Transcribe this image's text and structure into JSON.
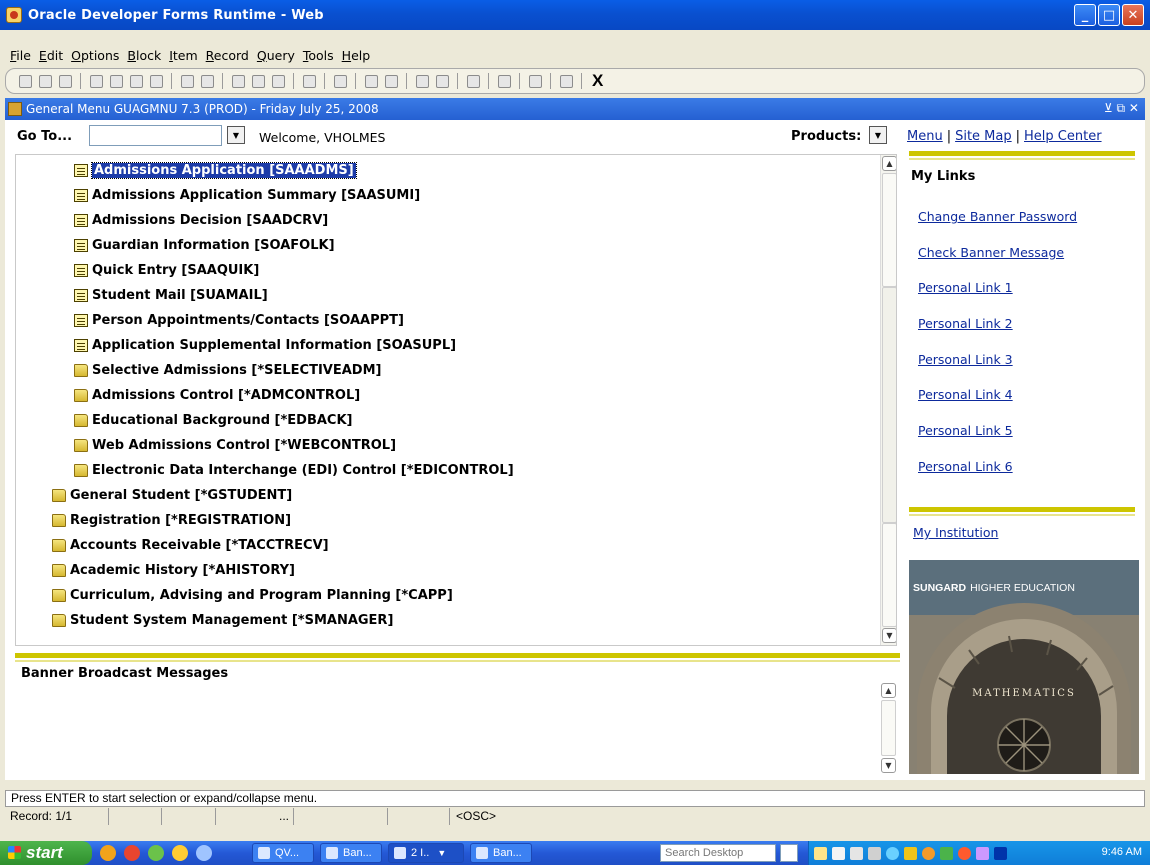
{
  "window": {
    "title": "Oracle Developer Forms Runtime - Web"
  },
  "menubar": [
    "File",
    "Edit",
    "Options",
    "Block",
    "Item",
    "Record",
    "Query",
    "Tools",
    "Help"
  ],
  "toolbar": {
    "exit_label": "X"
  },
  "form": {
    "title": "General Menu  GUAGMNU  7.3  (PROD) - Friday July 25, 2008"
  },
  "goto": {
    "label": "Go To...",
    "value": "",
    "welcome": "Welcome, VHOLMES",
    "products_label": "Products:"
  },
  "tree": {
    "items": [
      {
        "label": "Admissions Application [SAAADMS]",
        "type": "form",
        "level": 2,
        "selected": true
      },
      {
        "label": "Admissions Application Summary [SAASUMI]",
        "type": "form",
        "level": 2
      },
      {
        "label": "Admissions Decision [SAADCRV]",
        "type": "form",
        "level": 2
      },
      {
        "label": "Guardian Information [SOAFOLK]",
        "type": "form",
        "level": 2
      },
      {
        "label": "Quick Entry [SAAQUIK]",
        "type": "form",
        "level": 2
      },
      {
        "label": "Student Mail [SUAMAIL]",
        "type": "form",
        "level": 2
      },
      {
        "label": "Person Appointments/Contacts [SOAAPPT]",
        "type": "form",
        "level": 2
      },
      {
        "label": "Application Supplemental Information [SOASUPL]",
        "type": "form",
        "level": 2
      },
      {
        "label": "Selective Admissions [*SELECTIVEADM]",
        "type": "folder",
        "level": 2
      },
      {
        "label": "Admissions Control [*ADMCONTROL]",
        "type": "folder",
        "level": 2
      },
      {
        "label": "Educational Background [*EDBACK]",
        "type": "folder",
        "level": 2
      },
      {
        "label": "Web Admissions Control [*WEBCONTROL]",
        "type": "folder",
        "level": 2
      },
      {
        "label": "Electronic Data Interchange (EDI) Control [*EDICONTROL]",
        "type": "folder",
        "level": 2
      },
      {
        "label": "General Student [*GSTUDENT]",
        "type": "folder",
        "level": 1
      },
      {
        "label": "Registration [*REGISTRATION]",
        "type": "folder",
        "level": 1
      },
      {
        "label": "Accounts Receivable [*TACCTRECV]",
        "type": "folder",
        "level": 1
      },
      {
        "label": "Academic History [*AHISTORY]",
        "type": "folder",
        "level": 1
      },
      {
        "label": "Curriculum, Advising and Program Planning [*CAPP]",
        "type": "folder",
        "level": 1
      },
      {
        "label": "Student System Management [*SMANAGER]",
        "type": "folder",
        "level": 1
      }
    ]
  },
  "broadcast": {
    "title": "Banner Broadcast Messages"
  },
  "right": {
    "top_links": [
      "Menu",
      "Site Map",
      "Help Center"
    ],
    "my_links_title": "My Links",
    "links": [
      "Change Banner Password",
      "Check Banner Message",
      "Personal Link 1",
      "Personal Link 2",
      "Personal Link 3",
      "Personal Link 4",
      "Personal Link 5",
      "Personal Link 6"
    ],
    "institution_link": "My Institution",
    "logo_brand": "SUNGARD",
    "logo_text": "HIGHER EDUCATION",
    "logo_arch_text": "MATHEMATICS"
  },
  "status": {
    "message": "Press ENTER to start selection or expand/collapse menu.",
    "record": "Record: 1/1",
    "ellipsis": "...",
    "mode": "<OSC>"
  },
  "taskbar": {
    "start_label": "start",
    "tasks": [
      "QV...",
      "Ban...",
      "2 I..",
      "Ban..."
    ],
    "search_placeholder": "Search Desktop",
    "clock": "9:46 AM"
  },
  "colors": {
    "title_blue": "#0a5ee6",
    "gold_rule": "#cdc500",
    "link_blue": "#0d2a9c",
    "selection": "#1c3ba8"
  }
}
